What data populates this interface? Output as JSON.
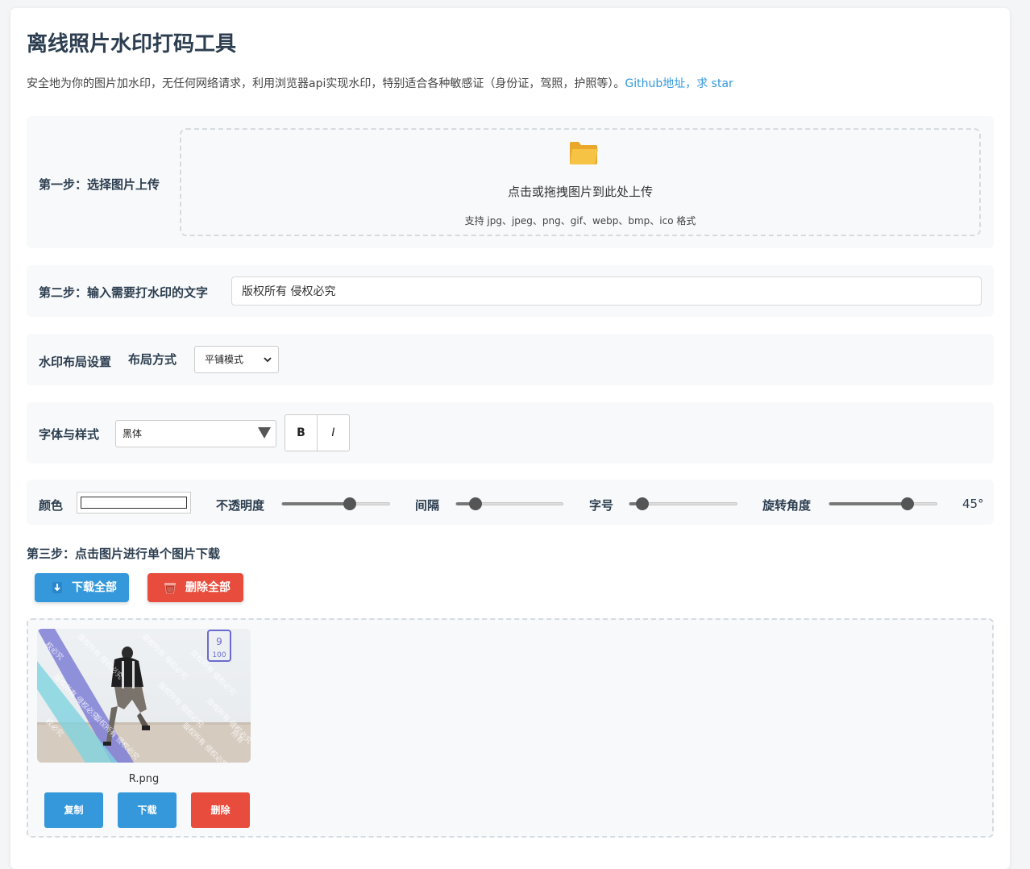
{
  "header": {
    "title": "离线照片水印打码工具",
    "description": "安全地为你的图片加水印，无任何网络请求，利用浏览器api实现水印，特别适合各种敏感证（身份证，驾照，护照等）。",
    "github_link": "Github地址，求 star"
  },
  "step1": {
    "label": "第一步：选择图片上传",
    "upload_text": "点击或拖拽图片到此处上传",
    "upload_hint": "支持 jpg、jpeg、png、gif、webp、bmp、ico 格式"
  },
  "step2": {
    "label": "第二步：输入需要打水印的文字",
    "value": "版权所有 侵权必究"
  },
  "layout": {
    "label": "水印布局设置",
    "mode_label": "布局方式",
    "mode_value": "平铺模式"
  },
  "font": {
    "label": "字体与样式",
    "family_value": "黑体",
    "bold_label": "B",
    "italic_label": "I"
  },
  "style": {
    "color_label": "颜色",
    "opacity_label": "不透明度",
    "opacity_fraction": 0.63,
    "spacing_label": "间隔",
    "spacing_fraction": 0.18,
    "size_label": "字号",
    "size_fraction": 0.12,
    "rotation_label": "旋转角度",
    "rotation_fraction": 0.73,
    "rotation_value": "45°"
  },
  "step3": {
    "label": "第三步：点击图片进行单个图片下载",
    "download_all": "下载全部",
    "delete_all": "删除全部"
  },
  "gallery": {
    "items": [
      {
        "filename": "R.png",
        "copy": "复制",
        "download": "下载",
        "delete": "删除"
      }
    ]
  },
  "colors": {
    "primary": "#3498db",
    "danger": "#e74c3c",
    "title": "#2c3e50",
    "folder": "#f6c344"
  },
  "icons": {
    "upload": "folder-icon",
    "download_all": "download-arrow-icon",
    "delete_all": "trash-basket-icon"
  }
}
